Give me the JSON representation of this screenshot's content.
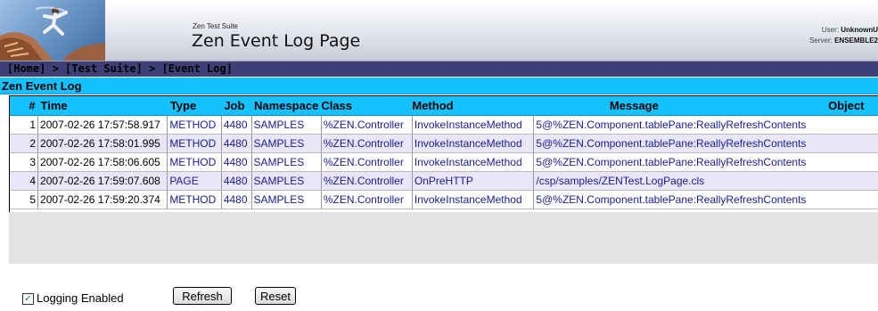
{
  "header": {
    "suite_title": "Zen Test Suite",
    "page_title": "Zen Event Log Page",
    "user_label": "User:",
    "user_value": "UnknownU",
    "server_label": "Server:",
    "server_value": "ENSEMBLE2"
  },
  "breadcrumb": {
    "home": "[Home]",
    "sep1": " > ",
    "suite": "[Test Suite]",
    "sep2": " > ",
    "log": "[Event Log]"
  },
  "table": {
    "caption": "Zen Event Log",
    "columns": [
      "#",
      "Time",
      "Type",
      "Job",
      "Namespace",
      "Class",
      "Method",
      "Message",
      "Object"
    ],
    "rows": [
      {
        "n": "1",
        "time": "2007-02-26 17:57:58.917",
        "type": "METHOD",
        "job": "4480",
        "ns": "SAMPLES",
        "cls": "%ZEN.Controller",
        "method": "InvokeInstanceMethod",
        "msg": "5@%ZEN.Component.tablePane:ReallyRefreshContents"
      },
      {
        "n": "2",
        "time": "2007-02-26 17:58:01.995",
        "type": "METHOD",
        "job": "4480",
        "ns": "SAMPLES",
        "cls": "%ZEN.Controller",
        "method": "InvokeInstanceMethod",
        "msg": "5@%ZEN.Component.tablePane:ReallyRefreshContents"
      },
      {
        "n": "3",
        "time": "2007-02-26 17:58:06.605",
        "type": "METHOD",
        "job": "4480",
        "ns": "SAMPLES",
        "cls": "%ZEN.Controller",
        "method": "InvokeInstanceMethod",
        "msg": "5@%ZEN.Component.tablePane:ReallyRefreshContents"
      },
      {
        "n": "4",
        "time": "2007-02-26 17:59:07.608",
        "type": "PAGE",
        "job": "4480",
        "ns": "SAMPLES",
        "cls": "%ZEN.Controller",
        "method": "OnPreHTTP",
        "msg": "/csp/samples/ZENTest.LogPage.cls"
      },
      {
        "n": "5",
        "time": "2007-02-26 17:59:20.374",
        "type": "METHOD",
        "job": "4480",
        "ns": "SAMPLES",
        "cls": "%ZEN.Controller",
        "method": "InvokeInstanceMethod",
        "msg": "5@%ZEN.Component.tablePane:ReallyRefreshContents"
      }
    ]
  },
  "controls": {
    "logging_label": "Logging Enabled",
    "logging_checked": "✓",
    "refresh_label": "Refresh",
    "reset_label": "Reset"
  }
}
